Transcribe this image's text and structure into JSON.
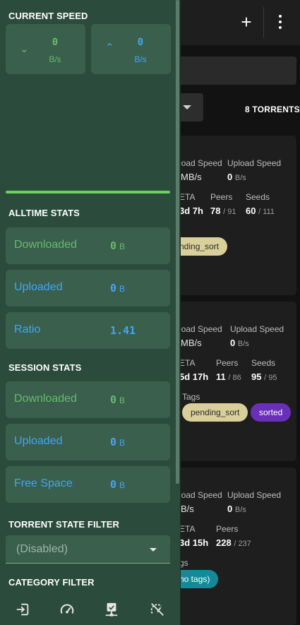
{
  "header": {
    "add_icon": "plus-icon",
    "menu_icon": "more-vert-icon"
  },
  "list": {
    "torrent_count": "8 TORRENTS"
  },
  "torrents": [
    {
      "download_speed_label": "load Speed",
      "upload_speed_label": "Upload Speed",
      "download_speed_value": "MB/s",
      "upload_speed_num": "0",
      "upload_speed_unit": "B/s",
      "eta_label": "ETA",
      "peers_label": "Peers",
      "seeds_label": "Seeds",
      "eta_value": "3d 7h",
      "peers_num": "78",
      "peers_total": "/ 91",
      "seeds_num": "60",
      "seeds_total": "/ 111",
      "tags": [
        "nding_sort"
      ]
    },
    {
      "download_speed_label": "load Speed",
      "upload_speed_label": "Upload Speed",
      "download_speed_value": "MB/s",
      "upload_speed_num": "0",
      "upload_speed_unit": "B/s",
      "eta_label": "ETA",
      "peers_label": "Peers",
      "seeds_label": "Seeds",
      "eta_value": "5d 17h",
      "peers_num": "11",
      "peers_total": "/ 86",
      "seeds_num": "95",
      "seeds_total": "/ 95",
      "tags_label": "Tags",
      "tags": [
        "pending_sort",
        "sorted"
      ]
    },
    {
      "download_speed_label": "load Speed",
      "upload_speed_label": "Upload Speed",
      "download_speed_value": "B/s",
      "upload_speed_num": "0",
      "upload_speed_unit": "B/s",
      "eta_label": "ETA",
      "peers_label": "Peers",
      "eta_value": "3d 15h",
      "peers_num": "228",
      "peers_total": "/ 237",
      "tags_label": "gs",
      "tags": [
        "no tags)"
      ]
    }
  ],
  "drawer": {
    "current_speed": {
      "title": "CURRENT SPEED",
      "download": {
        "value": "0",
        "unit": "B/s"
      },
      "upload": {
        "value": "0",
        "unit": "B/s"
      }
    },
    "alltime_stats": {
      "title": "ALLTIME STATS",
      "downloaded": {
        "label": "Downloaded",
        "value": "0",
        "unit": "B"
      },
      "uploaded": {
        "label": "Uploaded",
        "value": "0",
        "unit": "B"
      },
      "ratio": {
        "label": "Ratio",
        "value": "1.41"
      }
    },
    "session_stats": {
      "title": "SESSION STATS",
      "downloaded": {
        "label": "Downloaded",
        "value": "0",
        "unit": "B"
      },
      "uploaded": {
        "label": "Uploaded",
        "value": "0",
        "unit": "B"
      },
      "free_space": {
        "label": "Free Space",
        "value": "0",
        "unit": "B"
      }
    },
    "state_filter": {
      "title": "TORRENT STATE FILTER",
      "selected": "(Disabled)"
    },
    "category_filter": {
      "title": "CATEGORY FILTER"
    },
    "bottom_icons": [
      "logout-icon",
      "speedometer-icon",
      "server-network-icon",
      "speed-limit-off-icon"
    ]
  },
  "colors": {
    "drawer_bg": "#2b4b3c",
    "tile_bg": "#3a5f4d",
    "download": "#66bb6a",
    "upload": "#42a5f5",
    "progress": "#6bd15a"
  }
}
